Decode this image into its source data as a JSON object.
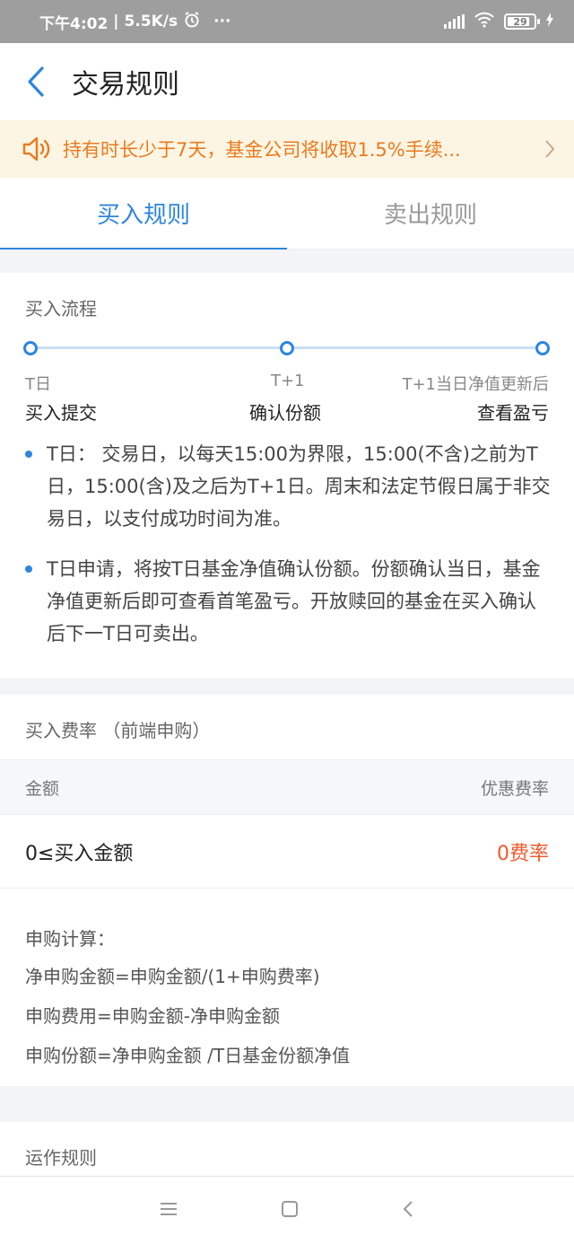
{
  "status_bar": {
    "time": "下午4:02",
    "speed": "5.5K/s",
    "more": "···",
    "battery": "29"
  },
  "header": {
    "title": "交易规则"
  },
  "notice": {
    "text": "持有时长少于7天，基金公司将收取1.5%手续..."
  },
  "tabs": [
    {
      "label": "买入规则",
      "active": true
    },
    {
      "label": "卖出规则",
      "active": false
    }
  ],
  "flow": {
    "title": "买入流程",
    "steps": [
      {
        "label": "T日",
        "action": "买入提交"
      },
      {
        "label": "T+1",
        "action": "确认份额"
      },
      {
        "label": "T+1当日净值更新后",
        "action": "查看盈亏"
      }
    ],
    "notes": [
      "T日： 交易日，以每天15:00为界限，15:00(不含)之前为T日，15:00(含)及之后为T+1日。周末和法定节假日属于非交易日，以支付成功时间为准。",
      "T日申请，将按T日基金净值确认份额。份额确认当日，基金净值更新后即可查看首笔盈亏。开放赎回的基金在买入确认后下一T日可卖出。"
    ]
  },
  "fee": {
    "title": "买入费率 （前端申购）",
    "col_amount": "金额",
    "col_rate": "优惠费率",
    "rows": [
      {
        "amount": "0≤买入金额",
        "rate": "0费率"
      }
    ],
    "calc_title": "申购计算：",
    "formulas": [
      "净申购金额=申购金额/(1+申购费率)",
      "申购费用=申购金额-净申购金额",
      "申购份额=净申购金额 /T日基金份额净值"
    ]
  },
  "operation": {
    "title": "运作规则"
  },
  "colors": {
    "accent": "#2e86de",
    "notice_text": "#ea7a1f",
    "notice_bg": "#fdf5e3",
    "fee_rate": "#ef5a2c"
  },
  "icons": [
    "back-arrow-icon",
    "speaker-icon",
    "chevron-right-icon",
    "alarm-icon",
    "signal-icon",
    "wifi-icon",
    "battery-icon",
    "charging-icon",
    "menu-nav-icon",
    "home-nav-icon",
    "back-nav-icon"
  ]
}
